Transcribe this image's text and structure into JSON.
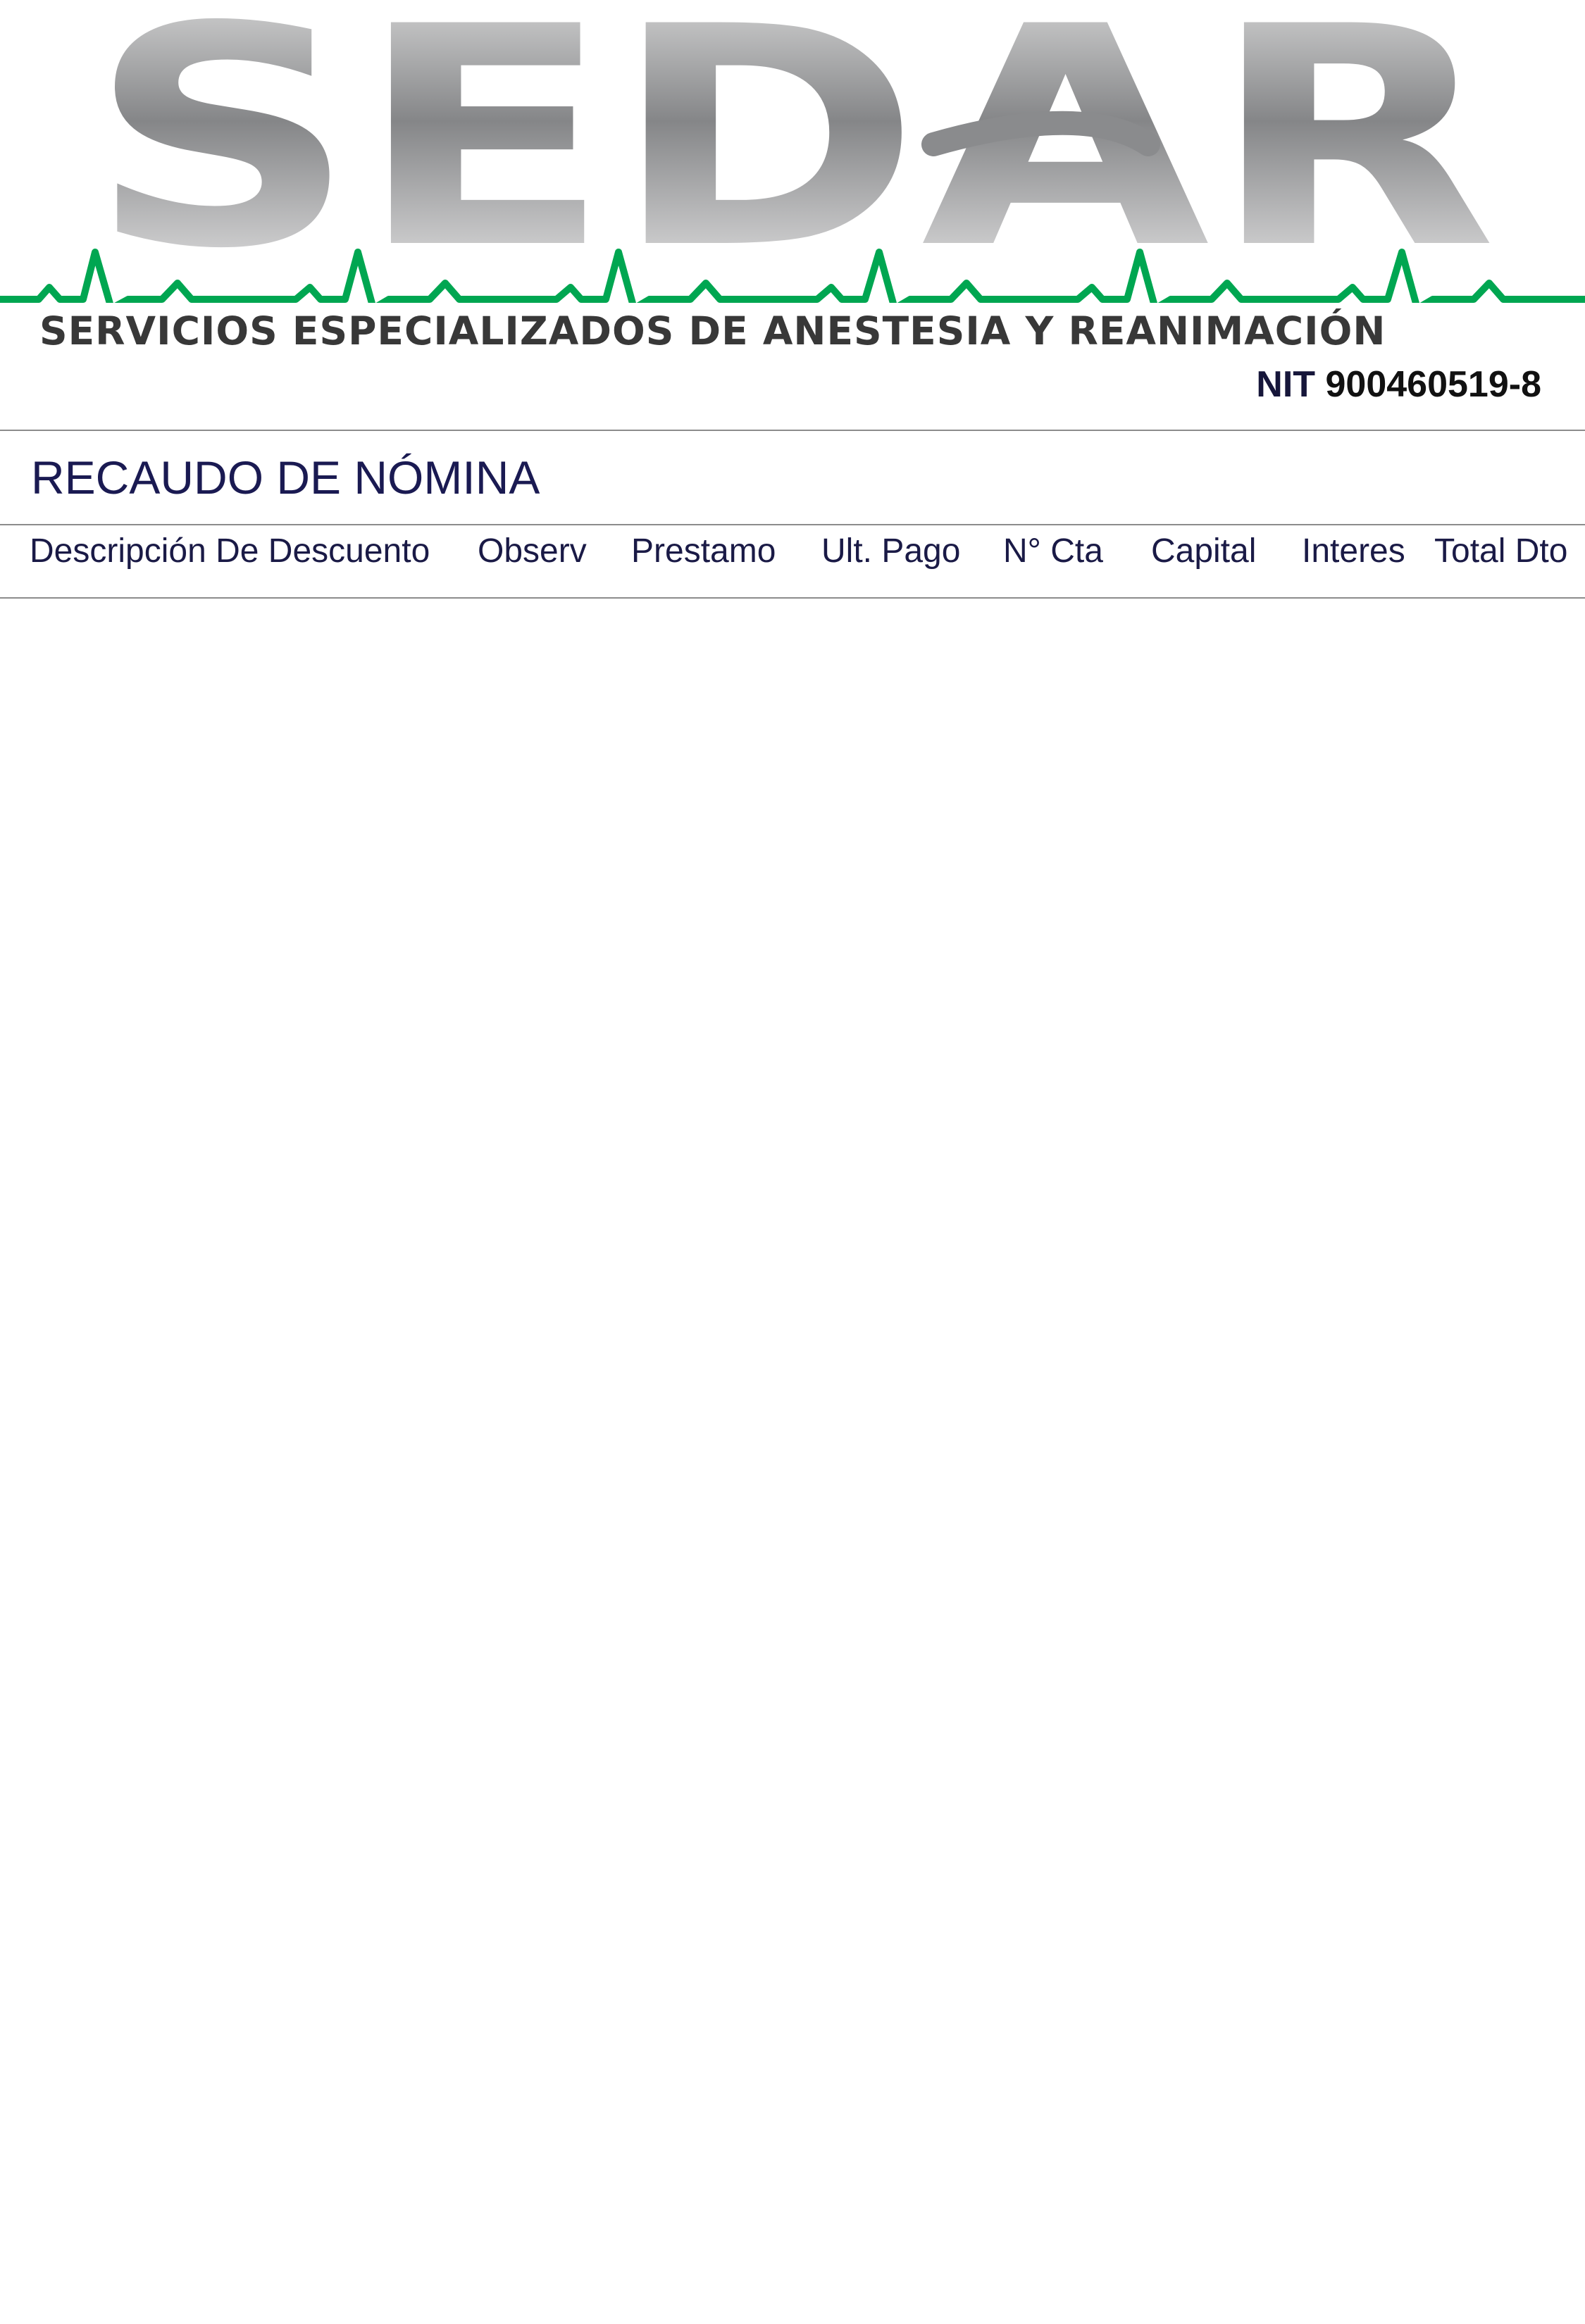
{
  "header": {
    "logo_text": "SEDAR",
    "tagline": "SERVICIOS ESPECIALIZADOS DE ANESTESIA Y REANIMACIÓN",
    "nit_label": "NIT",
    "nit_number": "900460519-8"
  },
  "document": {
    "title": "RECAUDO DE NÓMINA"
  },
  "table": {
    "columns": [
      "Descripción De Descuento",
      "Observ",
      "Prestamo",
      "Ult. Pago",
      "N° Cta",
      "Capital",
      "Interes",
      "Total Dto"
    ],
    "rows": []
  },
  "colors": {
    "logo_gray_dark": "#808184",
    "logo_gray_light": "#ffffff",
    "ecg_green": "#00a651",
    "tagline": "#383838",
    "title_navy": "#1a1a52",
    "rule_gray": "#8c8c8c"
  }
}
